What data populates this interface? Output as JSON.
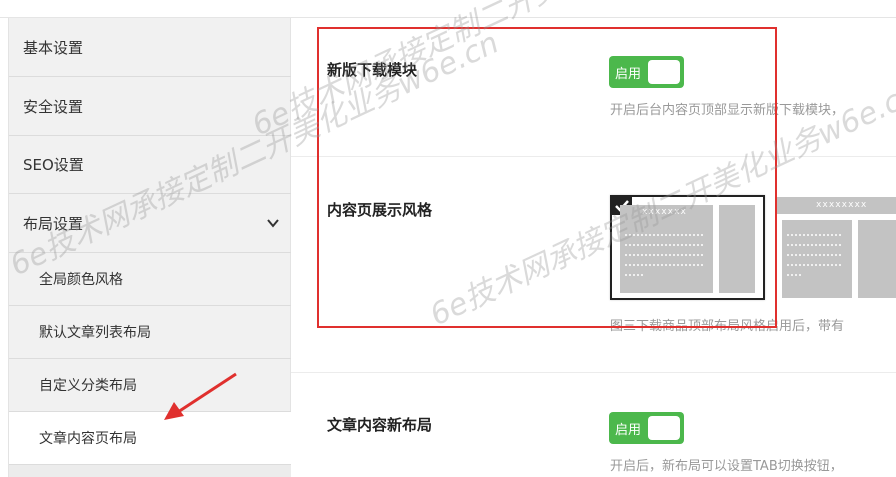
{
  "sidebar": {
    "items": [
      {
        "label": "基本设置"
      },
      {
        "label": "安全设置"
      },
      {
        "label": "SEO设置"
      },
      {
        "label": "布局设置"
      }
    ],
    "sub_items": [
      {
        "label": "全局颜色风格"
      },
      {
        "label": "默认文章列表布局"
      },
      {
        "label": "自定义分类布局"
      },
      {
        "label": "文章内容页布局"
      }
    ]
  },
  "settings": [
    {
      "label": "新版下载模块",
      "toggle_label": "启用",
      "description": "开启后台内容页顶部显示新版下载模块，"
    },
    {
      "label": "内容页展示风格",
      "thumb_header": "xxxxxxx",
      "thumb_header2": "xxxxxxxx",
      "description": "图三下载商品顶部布局风格启用后，带有"
    },
    {
      "label": "文章内容新布局",
      "toggle_label": "启用",
      "description": "开启后，新布局可以设置TAB切换按钮，"
    }
  ],
  "watermark": [
    "6e技术网承接定制二开美化业务w6e.cn",
    "6e技术网承接定制二开美化业务w6e.cn",
    "6e技术网承接定制二开美化业务w6e.cn"
  ],
  "colors": {
    "accent": "#4cb84c",
    "highlight": "#e0302e"
  }
}
